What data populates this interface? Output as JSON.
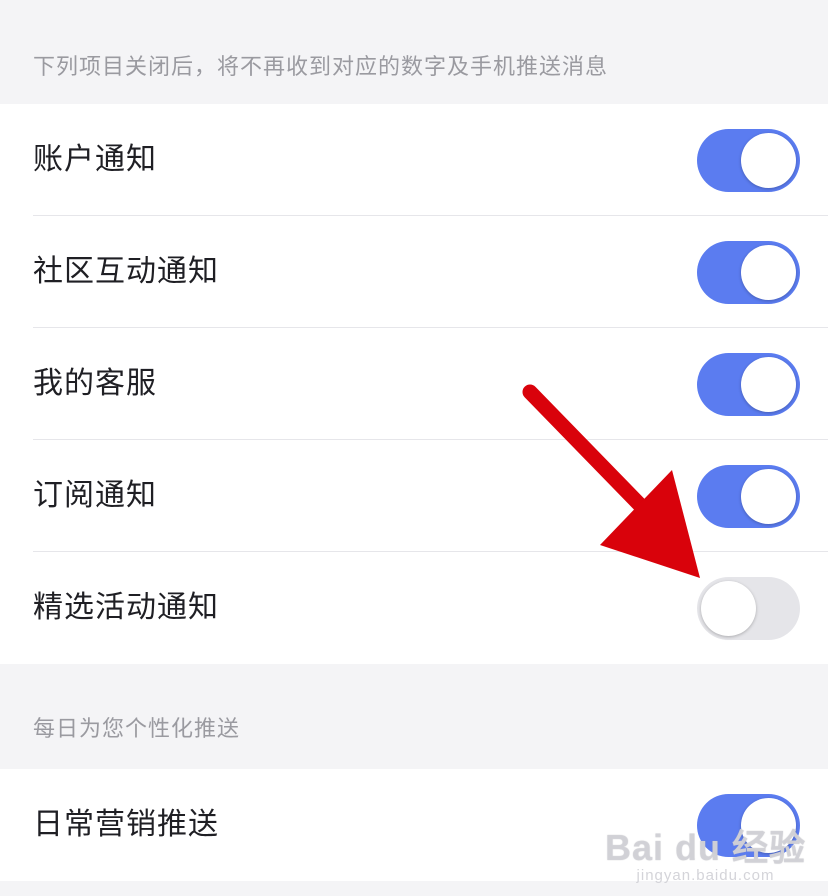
{
  "section1": {
    "header": "下列项目关闭后，将不再收到对应的数字及手机推送消息",
    "items": [
      {
        "label": "账户通知",
        "enabled": true
      },
      {
        "label": "社区互动通知",
        "enabled": true
      },
      {
        "label": "我的客服",
        "enabled": true
      },
      {
        "label": "订阅通知",
        "enabled": true
      },
      {
        "label": "精选活动通知",
        "enabled": false
      }
    ]
  },
  "section2": {
    "header": "每日为您个性化推送",
    "items": [
      {
        "label": "日常营销推送",
        "enabled": true
      }
    ]
  },
  "colors": {
    "toggle_on": "#5b7cf0",
    "toggle_off": "#e5e5e9",
    "annotation_arrow": "#d9020b"
  },
  "annotation": {
    "icon": "red-arrow-icon"
  },
  "watermark": {
    "main": "Bai du 经验",
    "sub": "jingyan.baidu.com"
  }
}
